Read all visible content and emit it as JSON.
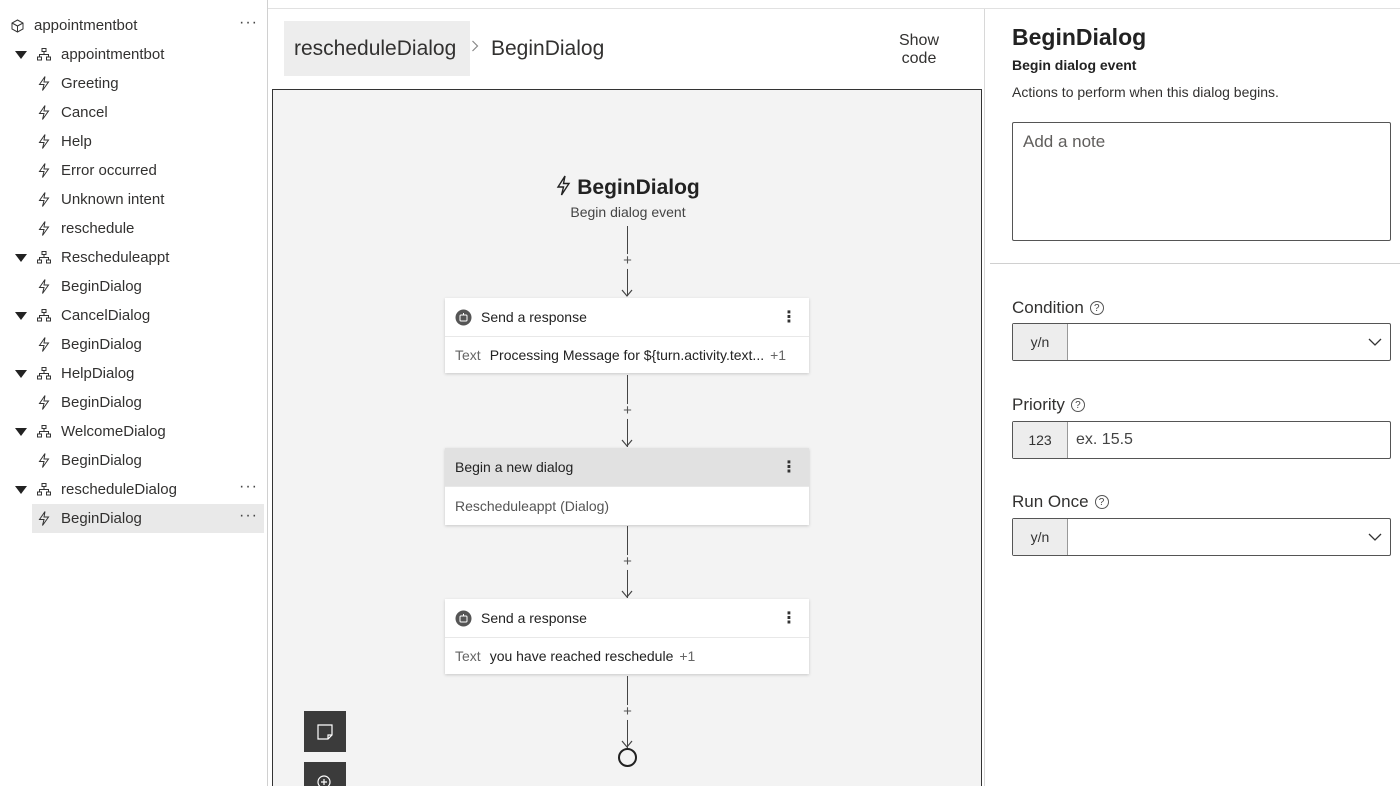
{
  "tree": {
    "root": {
      "label": "appointmentbot",
      "more": "···"
    },
    "dialogs": [
      {
        "label": "appointmentbot",
        "triggers": [
          "Greeting",
          "Cancel",
          "Help",
          "Error occurred",
          "Unknown intent",
          "reschedule"
        ]
      },
      {
        "label": "Rescheduleappt",
        "triggers": [
          "BeginDialog"
        ]
      },
      {
        "label": "CancelDialog",
        "triggers": [
          "BeginDialog"
        ]
      },
      {
        "label": "HelpDialog",
        "triggers": [
          "BeginDialog"
        ]
      },
      {
        "label": "WelcomeDialog",
        "triggers": [
          "BeginDialog"
        ]
      },
      {
        "label": "rescheduleDialog",
        "more": "···",
        "triggers": [
          "BeginDialog"
        ],
        "selected_trigger": "BeginDialog",
        "selected_more": "···"
      }
    ]
  },
  "header": {
    "breadcrumb_root": "rescheduleDialog",
    "breadcrumb_current": "BeginDialog",
    "show_code": "Show code"
  },
  "canvas": {
    "trigger_title": "BeginDialog",
    "trigger_subtitle": "Begin dialog event",
    "nodes": [
      {
        "title": "Send a response",
        "kind": "Text",
        "text": "Processing Message for ${turn.activity.text...",
        "extra": "+1"
      },
      {
        "title": "Begin a new dialog",
        "text": "Rescheduleappt (Dialog)"
      },
      {
        "title": "Send a response",
        "kind": "Text",
        "text": "you have reached reschedule",
        "extra": "+1"
      }
    ],
    "kebab": "⋮"
  },
  "properties": {
    "title": "BeginDialog",
    "subtitle": "Begin dialog event",
    "description": "Actions to perform when this dialog begins.",
    "note_placeholder": "Add a note",
    "condition": {
      "label": "Condition",
      "prefix": "y/n",
      "value": ""
    },
    "priority": {
      "label": "Priority",
      "prefix": "123",
      "placeholder": "ex. 15.5"
    },
    "run_once": {
      "label": "Run Once",
      "prefix": "y/n",
      "value": ""
    }
  }
}
